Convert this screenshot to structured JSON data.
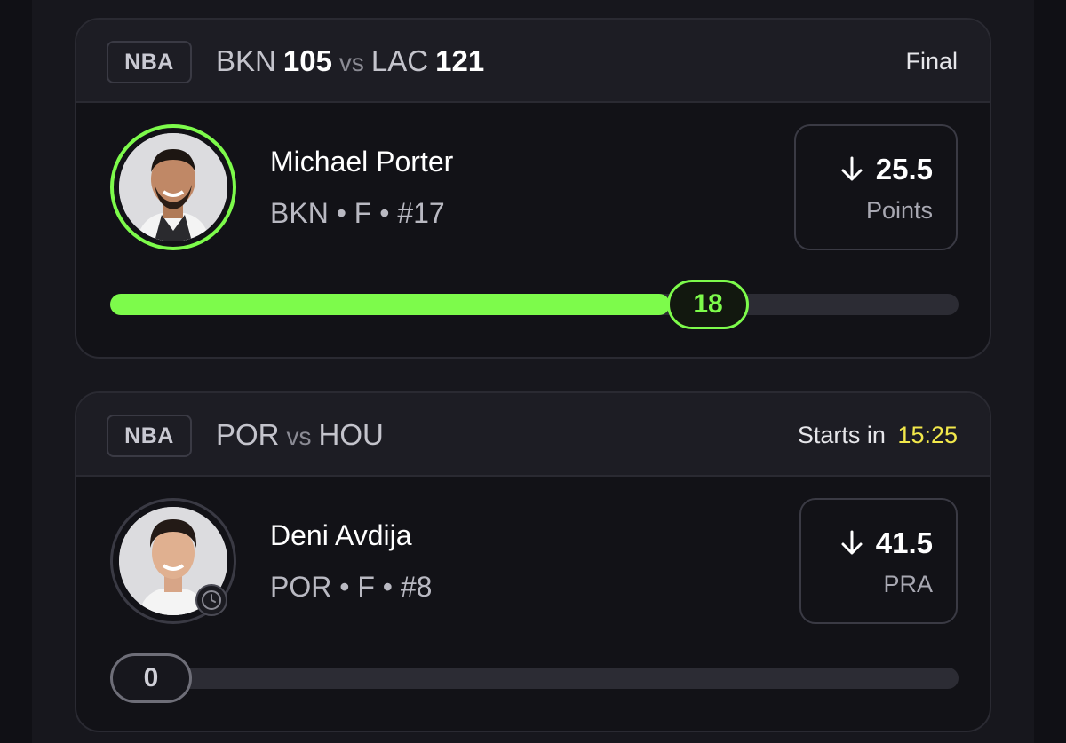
{
  "cards": [
    {
      "league": "NBA",
      "home_team": "BKN",
      "home_score": "105",
      "vs": "vs",
      "away_team": "LAC",
      "away_score": "121",
      "status": "Final",
      "player": {
        "name": "Michael Porter",
        "meta": "BKN • F • #17",
        "avatar_ring_color": "#7dfb4b"
      },
      "line": {
        "direction": "down-arrow-icon",
        "value": "25.5",
        "stat": "Points"
      },
      "progress": {
        "current": "18",
        "fraction": 0.66,
        "color": "#7dfb4b"
      }
    },
    {
      "league": "NBA",
      "home_team": "POR",
      "vs": "vs",
      "away_team": "HOU",
      "status_prefix": "Starts in",
      "countdown": "15:25",
      "player": {
        "name": "Deni Avdija",
        "meta": "POR • F • #8",
        "avatar_ring_color": "#3a3a44"
      },
      "line": {
        "direction": "down-arrow-icon",
        "value": "41.5",
        "stat": "PRA"
      },
      "progress": {
        "current": "0",
        "fraction": 0.0,
        "color": "#7dfb4b"
      }
    }
  ],
  "colors": {
    "background": "#101015",
    "accent_green": "#7dfb4b",
    "countdown_yellow": "#f2e84b"
  }
}
